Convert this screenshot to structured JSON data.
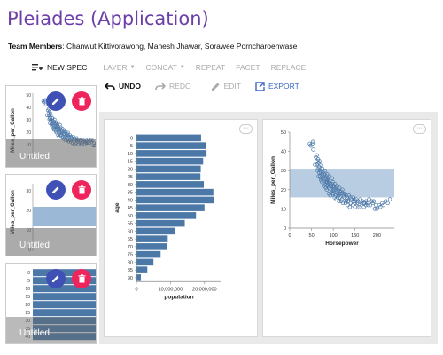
{
  "app": {
    "title": "Pleiades (Application)",
    "team_label": "Team Members",
    "team_members": ": Chanwut Kittivorawong, Manesh Jhawar, Sorawee Porncharoenwase"
  },
  "toolbar": {
    "new_spec": "NEW SPEC",
    "layer": "LAYER",
    "concat": "CONCAT",
    "repeat": "REPEAT",
    "facet": "FACET",
    "replace": "REPLACE",
    "undo": "UNDO",
    "redo": "REDO",
    "edit": "EDIT",
    "export": "EXPORT"
  },
  "sidebar": {
    "thumbnails": [
      {
        "label": "Untitled",
        "y_axis_title": "Miles_per_Gallon",
        "y_ticks": [
          "50",
          "40",
          "30",
          "20",
          "10",
          "0"
        ]
      },
      {
        "label": "Untitled",
        "y_axis_title": "Miles_per_Gallon",
        "y_ticks": [
          "30",
          "20",
          "10",
          "0"
        ]
      },
      {
        "label": "Untitled",
        "y_ticks": [
          "0",
          "5",
          "10",
          "15",
          "20",
          "25",
          "30",
          "35",
          "40"
        ]
      }
    ]
  },
  "colors": {
    "accent_purple": "#6c3fa8",
    "bar_blue": "#4c78a8",
    "edit_button": "#3f51b5",
    "delete_button": "#f0245c",
    "export_blue": "#3a66c4",
    "band_fill": "#9bb8d6"
  },
  "chart_data": [
    {
      "type": "bar",
      "orientation": "horizontal",
      "xlabel": "population",
      "ylabel": "age",
      "categories": [
        "0",
        "5",
        "10",
        "15",
        "20",
        "25",
        "30",
        "35",
        "40",
        "45",
        "50",
        "55",
        "60",
        "65",
        "70",
        "75",
        "80",
        "85",
        "90"
      ],
      "values": [
        19000000,
        20500000,
        20600000,
        19600000,
        18900000,
        18800000,
        19800000,
        22600000,
        22700000,
        20000000,
        17500000,
        14200000,
        11300000,
        9200000,
        8900000,
        7100000,
        5000000,
        3200000,
        1300000
      ],
      "xticks": [
        "0",
        "10,000,000",
        "20,000,000"
      ],
      "xlim": [
        0,
        25000000
      ]
    },
    {
      "type": "scatter",
      "xlabel": "Horsepower",
      "ylabel": "Miles_per_Gallon",
      "xlim": [
        0,
        240
      ],
      "ylim": [
        0,
        50
      ],
      "xticks": [
        "0",
        "50",
        "100",
        "150",
        "200"
      ],
      "yticks": [
        "0",
        "10",
        "20",
        "30",
        "40",
        "50"
      ],
      "selection_band": {
        "y_from": 16,
        "y_to": 31
      },
      "points": [
        [
          46,
          44
        ],
        [
          48,
          43
        ],
        [
          52,
          44
        ],
        [
          53,
          45
        ],
        [
          54,
          41
        ],
        [
          60,
          37
        ],
        [
          62,
          38
        ],
        [
          65,
          36
        ],
        [
          67,
          34
        ],
        [
          68,
          35
        ],
        [
          65,
          31
        ],
        [
          67,
          32
        ],
        [
          70,
          30
        ],
        [
          70,
          33
        ],
        [
          72,
          29
        ],
        [
          75,
          28
        ],
        [
          75,
          31
        ],
        [
          78,
          27
        ],
        [
          80,
          28
        ],
        [
          82,
          26
        ],
        [
          84,
          27
        ],
        [
          85,
          25
        ],
        [
          86,
          24
        ],
        [
          88,
          26
        ],
        [
          88,
          23
        ],
        [
          90,
          24
        ],
        [
          90,
          21
        ],
        [
          92,
          22
        ],
        [
          95,
          22
        ],
        [
          95,
          20
        ],
        [
          96,
          19
        ],
        [
          97,
          23
        ],
        [
          100,
          20
        ],
        [
          100,
          18
        ],
        [
          102,
          21
        ],
        [
          105,
          20
        ],
        [
          105,
          17
        ],
        [
          108,
          19
        ],
        [
          110,
          18
        ],
        [
          110,
          16
        ],
        [
          112,
          17
        ],
        [
          115,
          19
        ],
        [
          115,
          16
        ],
        [
          120,
          18
        ],
        [
          120,
          15
        ],
        [
          125,
          16
        ],
        [
          130,
          15
        ],
        [
          130,
          14
        ],
        [
          135,
          14
        ],
        [
          140,
          15
        ],
        [
          140,
          13
        ],
        [
          145,
          14
        ],
        [
          150,
          14
        ],
        [
          150,
          13
        ],
        [
          155,
          13
        ],
        [
          160,
          12
        ],
        [
          165,
          13
        ],
        [
          170,
          13
        ],
        [
          175,
          14
        ],
        [
          180,
          12
        ],
        [
          190,
          13
        ],
        [
          198,
          12
        ],
        [
          200,
          10
        ],
        [
          208,
          11
        ],
        [
          215,
          12
        ],
        [
          220,
          14
        ],
        [
          225,
          13
        ],
        [
          230,
          15
        ],
        [
          58,
          33
        ],
        [
          63,
          33
        ],
        [
          66,
          27
        ],
        [
          70,
          27
        ],
        [
          72,
          25
        ],
        [
          74,
          24
        ],
        [
          76,
          26
        ],
        [
          78,
          22
        ],
        [
          80,
          23
        ],
        [
          83,
          21
        ],
        [
          85,
          20
        ],
        [
          87,
          22
        ],
        [
          90,
          18
        ],
        [
          93,
          17
        ],
        [
          98,
          18
        ],
        [
          103,
          16
        ],
        [
          107,
          15
        ],
        [
          113,
          14
        ],
        [
          118,
          14
        ],
        [
          122,
          13
        ],
        [
          128,
          13
        ],
        [
          133,
          12
        ],
        [
          138,
          11
        ],
        [
          145,
          12
        ],
        [
          150,
          11
        ],
        [
          160,
          11
        ],
        [
          170,
          11
        ],
        [
          175,
          12
        ],
        [
          185,
          12
        ],
        [
          195,
          10
        ],
        [
          62,
          35
        ],
        [
          64,
          30
        ],
        [
          68,
          29
        ],
        [
          71,
          26
        ],
        [
          73,
          31
        ],
        [
          76,
          29
        ],
        [
          79,
          24
        ],
        [
          81,
          30
        ],
        [
          84,
          24
        ],
        [
          86,
          28
        ],
        [
          89,
          25
        ],
        [
          91,
          27
        ],
        [
          94,
          23
        ],
        [
          97,
          26
        ],
        [
          99,
          24
        ],
        [
          101,
          22
        ],
        [
          104,
          23
        ],
        [
          106,
          21
        ],
        [
          109,
          22
        ],
        [
          111,
          20
        ],
        [
          114,
          21
        ],
        [
          116,
          18
        ],
        [
          119,
          19
        ],
        [
          121,
          20
        ],
        [
          124,
          17
        ],
        [
          127,
          18
        ],
        [
          129,
          17
        ],
        [
          132,
          16
        ],
        [
          136,
          17
        ],
        [
          139,
          16
        ],
        [
          142,
          15
        ],
        [
          146,
          16
        ],
        [
          149,
          15
        ],
        [
          153,
          15
        ],
        [
          157,
          14
        ],
        [
          162,
          15
        ],
        [
          167,
          14
        ],
        [
          172,
          13
        ],
        [
          178,
          13
        ],
        [
          182,
          15
        ],
        [
          188,
          14
        ],
        [
          193,
          14
        ],
        [
          205,
          12
        ],
        [
          212,
          13
        ]
      ]
    }
  ]
}
